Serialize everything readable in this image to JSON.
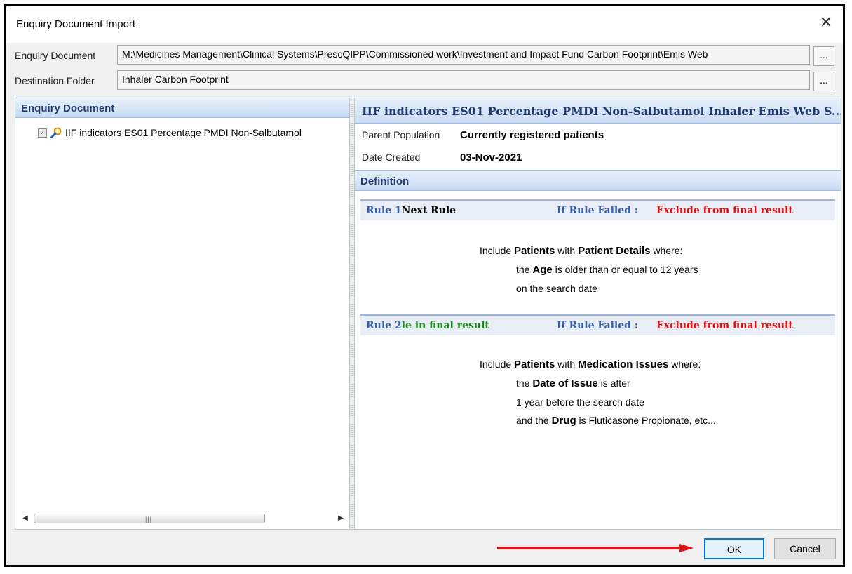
{
  "window": {
    "title": "Enquiry Document Import"
  },
  "fields": {
    "enquiry_label": "Enquiry Document",
    "enquiry_value": "M:\\Medicines Management\\Clinical Systems\\PrescQIPP\\Commissioned work\\Investment and Impact Fund Carbon Footprint\\Emis Web",
    "destination_label": "Destination Folder",
    "destination_value": "Inhaler Carbon Footprint",
    "browse_label": "..."
  },
  "left_pane": {
    "header": "Enquiry Document",
    "tree_item": "IIF indicators ES01 Percentage PMDI Non-Salbutamol"
  },
  "right_pane": {
    "title": "IIF indicators ES01 Percentage PMDI Non-Salbutamol Inhaler Emis Web S...",
    "parent_population_label": "Parent Population",
    "parent_population_value": "Currently registered patients",
    "date_created_label": "Date Created",
    "date_created_value": "03-Nov-2021",
    "definition_header": "Definition",
    "rules": [
      {
        "label": "Rule 1",
        "action": "Next Rule",
        "failed_label": "If Rule Failed :",
        "failed_value": "Exclude from final result",
        "lines": {
          "l1a": "Include ",
          "l1b": "Patients",
          "l1c": " with ",
          "l1d": "Patient Details",
          "l1e": " where:",
          "l2a": "the ",
          "l2b": "Age",
          "l2c": " is older than or equal to 12 years",
          "l3": "on the search date"
        }
      },
      {
        "label": "Rule 2",
        "action": "le in final result",
        "failed_label": "If Rule Failed :",
        "failed_value": "Exclude from final result",
        "lines": {
          "l1a": "Include ",
          "l1b": "Patients",
          "l1c": " with ",
          "l1d": "Medication Issues",
          "l1e": " where:",
          "l2a": "the ",
          "l2b": "Date of Issue",
          "l2c": " is after",
          "l3": "1 year before the search date",
          "l4a": "and the ",
          "l4b": "Drug",
          "l4c": " is Fluticasone Propionate, etc..."
        }
      }
    ]
  },
  "buttons": {
    "ok": "OK",
    "cancel": "Cancel"
  },
  "colors": {
    "accent": "#0078d7",
    "arrow": "#e01010",
    "header_text": "#1f3b72"
  }
}
